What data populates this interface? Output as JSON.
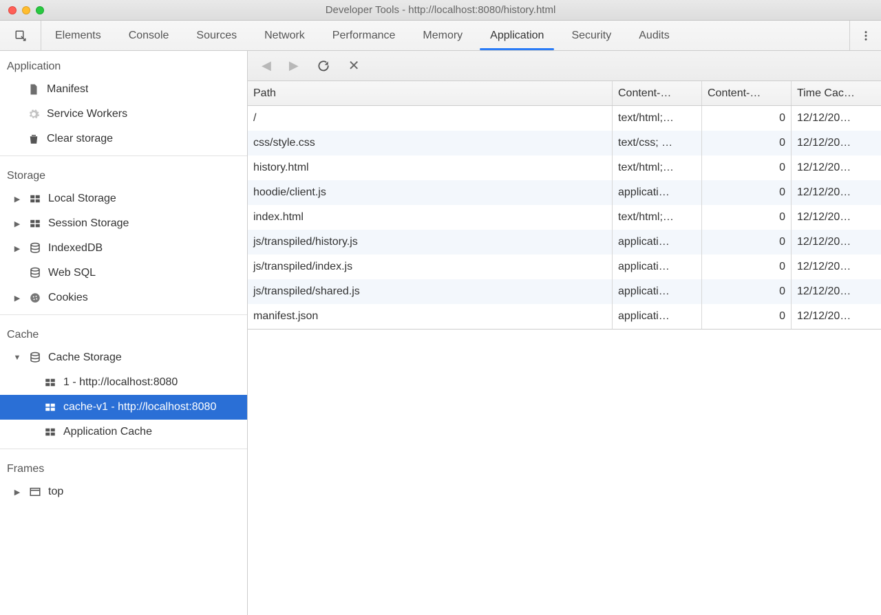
{
  "window_title": "Developer Tools - http://localhost:8080/history.html",
  "tabs": [
    "Elements",
    "Console",
    "Sources",
    "Network",
    "Performance",
    "Memory",
    "Application",
    "Security",
    "Audits"
  ],
  "active_tab": 6,
  "sidebar": {
    "application": {
      "label": "Application",
      "items": [
        {
          "icon": "file",
          "label": "Manifest"
        },
        {
          "icon": "gear",
          "label": "Service Workers"
        },
        {
          "icon": "trash",
          "label": "Clear storage"
        }
      ]
    },
    "storage": {
      "label": "Storage",
      "items": [
        {
          "expand": "▶",
          "icon": "grid",
          "label": "Local Storage"
        },
        {
          "expand": "▶",
          "icon": "grid",
          "label": "Session Storage"
        },
        {
          "expand": "▶",
          "icon": "db",
          "label": "IndexedDB"
        },
        {
          "expand": "",
          "icon": "db",
          "label": "Web SQL"
        },
        {
          "expand": "▶",
          "icon": "cookie",
          "label": "Cookies"
        }
      ]
    },
    "cache": {
      "label": "Cache",
      "items": [
        {
          "expand": "▼",
          "icon": "db",
          "label": "Cache Storage",
          "indent": 1,
          "children": [
            {
              "icon": "grid",
              "label": "1 - http://localhost:8080",
              "indent": 3
            },
            {
              "icon": "grid",
              "label": "cache-v1 - http://localhost:8080",
              "indent": 3,
              "selected": true
            }
          ]
        },
        {
          "expand": "",
          "icon": "grid",
          "label": "Application Cache",
          "indent": 2
        }
      ]
    },
    "frames": {
      "label": "Frames",
      "items": [
        {
          "expand": "▶",
          "icon": "frame",
          "label": "top"
        }
      ]
    }
  },
  "columns": [
    "Path",
    "Content-…",
    "Content-…",
    "Time Cac…"
  ],
  "rows": [
    {
      "path": "/",
      "ct": "text/html;…",
      "cl": "0",
      "tc": "12/12/20…"
    },
    {
      "path": "css/style.css",
      "ct": "text/css; …",
      "cl": "0",
      "tc": "12/12/20…"
    },
    {
      "path": "history.html",
      "ct": "text/html;…",
      "cl": "0",
      "tc": "12/12/20…"
    },
    {
      "path": "hoodie/client.js",
      "ct": "applicati…",
      "cl": "0",
      "tc": "12/12/20…"
    },
    {
      "path": "index.html",
      "ct": "text/html;…",
      "cl": "0",
      "tc": "12/12/20…"
    },
    {
      "path": "js/transpiled/history.js",
      "ct": "applicati…",
      "cl": "0",
      "tc": "12/12/20…"
    },
    {
      "path": "js/transpiled/index.js",
      "ct": "applicati…",
      "cl": "0",
      "tc": "12/12/20…"
    },
    {
      "path": "js/transpiled/shared.js",
      "ct": "applicati…",
      "cl": "0",
      "tc": "12/12/20…"
    },
    {
      "path": "manifest.json",
      "ct": "applicati…",
      "cl": "0",
      "tc": "12/12/20…"
    }
  ]
}
